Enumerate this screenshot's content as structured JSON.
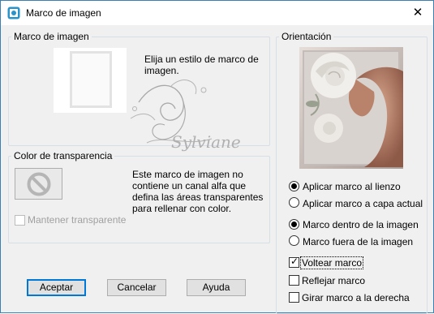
{
  "window": {
    "title": "Marco de imagen",
    "close_glyph": "✕"
  },
  "frame_group": {
    "legend": "Marco de imagen",
    "instruction": "Elija un estilo de marco de imagen."
  },
  "transparency_group": {
    "legend": "Color de transparencia",
    "message": "Este marco de imagen no contiene un canal alfa que defina las áreas transparentes para rellenar con color.",
    "keep_transparent_label": "Mantener transparente",
    "keep_transparent_checked": false,
    "keep_transparent_enabled": false
  },
  "orientation_group": {
    "legend": "Orientación",
    "apply_options": [
      {
        "label": "Aplicar marco al lienzo",
        "selected": true
      },
      {
        "label": "Aplicar marco a capa actual",
        "selected": false
      }
    ],
    "position_options": [
      {
        "label": "Marco dentro de la imagen",
        "selected": true
      },
      {
        "label": "Marco fuera de la imagen",
        "selected": false
      }
    ],
    "checkboxes": [
      {
        "label": "Voltear marco",
        "checked": true
      },
      {
        "label": "Reflejar marco",
        "checked": false
      },
      {
        "label": "Girar marco a la derecha",
        "checked": false
      }
    ]
  },
  "buttons": {
    "ok": "Aceptar",
    "cancel": "Cancelar",
    "help": "Ayuda"
  },
  "watermark": "Sylviane",
  "icons": {
    "app": "frame-app-icon",
    "close": "close-icon",
    "no_transparency": "no-entry-icon",
    "check": "checkmark-icon"
  },
  "colors": {
    "window_border": "#3c7fb1",
    "default_button_border": "#0078d7",
    "group_border": "#d5dfe5"
  }
}
